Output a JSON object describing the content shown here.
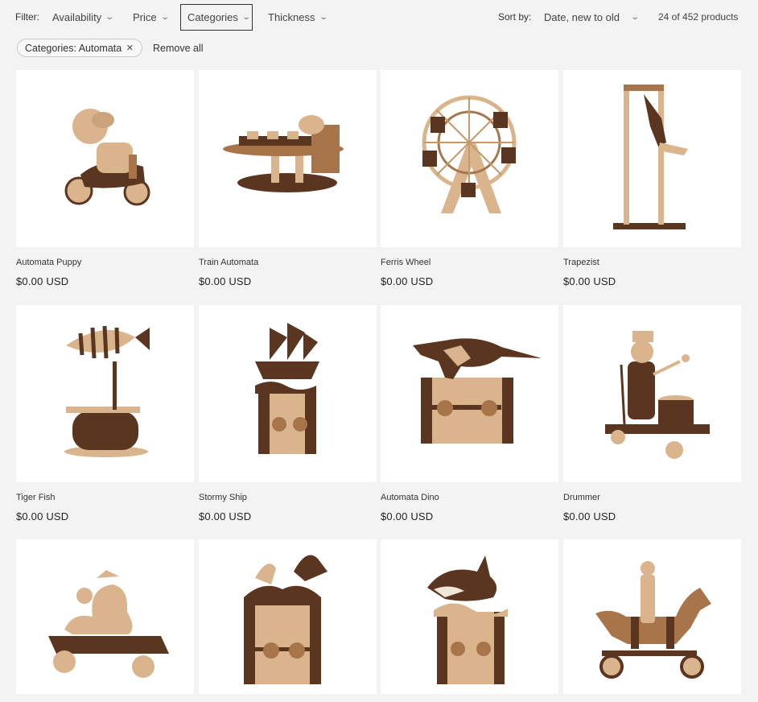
{
  "filters": {
    "label": "Filter:",
    "availability": "Availability",
    "price": "Price",
    "categories": "Categories",
    "thickness": "Thickness"
  },
  "sort": {
    "label": "Sort by:",
    "selected": "Date, new to old"
  },
  "count": "24 of 452 products",
  "active_facets": {
    "chip": "Categories: Automata",
    "remove_all": "Remove all"
  },
  "products": [
    {
      "title": "Automata Puppy",
      "price": "$0.00 USD"
    },
    {
      "title": "Train Automata",
      "price": "$0.00 USD"
    },
    {
      "title": "Ferris Wheel",
      "price": "$0.00 USD"
    },
    {
      "title": "Trapezist",
      "price": "$0.00 USD"
    },
    {
      "title": "Tiger Fish",
      "price": "$0.00 USD"
    },
    {
      "title": "Stormy Ship",
      "price": "$0.00 USD"
    },
    {
      "title": "Automata Dino",
      "price": "$0.00 USD"
    },
    {
      "title": "Drummer",
      "price": "$0.00 USD"
    },
    {
      "title": "",
      "price": ""
    },
    {
      "title": "",
      "price": ""
    },
    {
      "title": "",
      "price": ""
    },
    {
      "title": "",
      "price": ""
    }
  ],
  "colors": {
    "dark_wood": "#5a3620",
    "light_wood": "#d9b48c",
    "mid_wood": "#a8754a"
  }
}
